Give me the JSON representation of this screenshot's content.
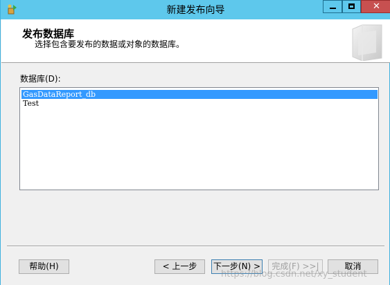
{
  "window": {
    "title": "新建发布向导",
    "close_glyph": "✕",
    "colors": {
      "titlebar": "#5ec8ec",
      "close": "#c75050",
      "selection": "#3399ff"
    }
  },
  "header": {
    "title": "发布数据库",
    "subtitle": "选择包含要发布的数据或对象的数据库。"
  },
  "database": {
    "label": "数据库(D):",
    "items": [
      "GasDataReport_db",
      "Test"
    ],
    "selected_index": 0
  },
  "buttons": {
    "help": "帮助(H)",
    "back": "< 上一步",
    "next": "下一步(N) >",
    "finish": "完成(F) >>|",
    "cancel": "取消"
  },
  "watermark": "https://blog.csdn.net/xy_student",
  "icons": [
    "app-icon",
    "minimize-icon",
    "maximize-icon",
    "close-icon",
    "wizard-graphic-icon"
  ]
}
